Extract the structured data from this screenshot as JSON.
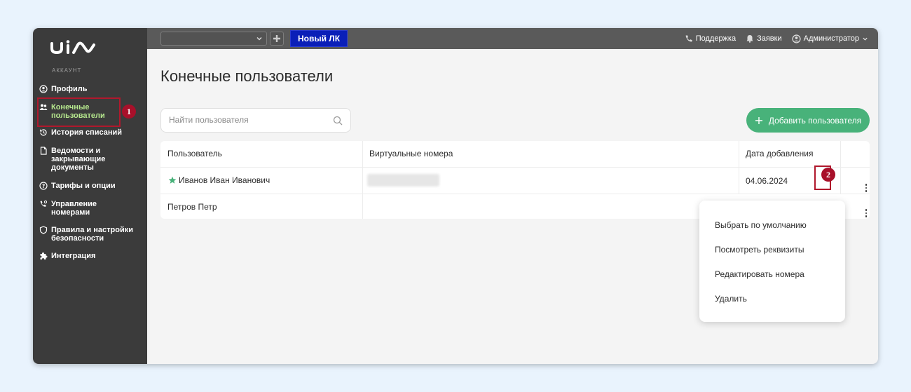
{
  "sidebar": {
    "section_label": "АККАУНТ",
    "items": [
      {
        "label": "Профиль",
        "icon": "user-circle-icon"
      },
      {
        "label": "Конечные пользователи",
        "icon": "users-icon"
      },
      {
        "label": "История списаний",
        "icon": "history-icon"
      },
      {
        "label": "Ведомости и закрывающие документы",
        "icon": "document-icon"
      },
      {
        "label": "Тарифы и опции",
        "icon": "tariff-icon"
      },
      {
        "label": "Управление номерами",
        "icon": "phone-settings-icon"
      },
      {
        "label": "Правила и настройки безопасности",
        "icon": "shield-icon"
      },
      {
        "label": "Интеграция",
        "icon": "puzzle-icon"
      }
    ],
    "active_index": 1
  },
  "topbar": {
    "new_lk": "Новый ЛК",
    "support": "Поддержка",
    "requests": "Заявки",
    "admin": "Администратор"
  },
  "main": {
    "title": "Конечные пользователи",
    "search_placeholder": "Найти пользователя",
    "add_button": "Добавить пользователя",
    "table": {
      "columns": [
        "Пользователь",
        "Виртуальные номера",
        "Дата добавления"
      ],
      "rows": [
        {
          "user": "Иванов Иван Иванович",
          "numbers": "",
          "date": "04.06.2024",
          "default": true
        },
        {
          "user": "Петров Петр",
          "numbers": "",
          "date": "",
          "default": false
        }
      ]
    }
  },
  "context_menu": {
    "items": [
      "Выбрать по умолчанию",
      "Посмотреть реквизиты",
      "Редактировать номера",
      "Удалить"
    ]
  },
  "annotations": {
    "badge1": "1",
    "badge2": "2"
  },
  "colors": {
    "accent_green": "#48b27a",
    "new_lk_blue": "#0a1fb8",
    "highlight_red": "#b0182c"
  }
}
